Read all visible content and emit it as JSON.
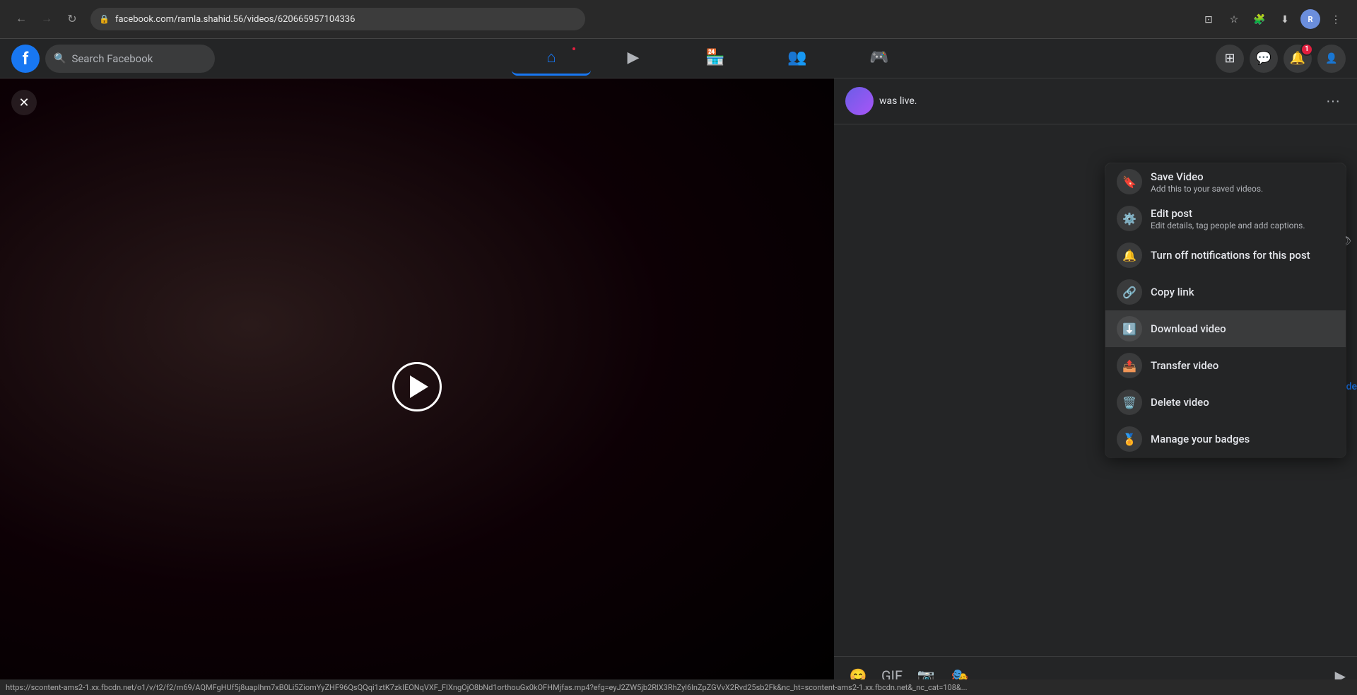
{
  "browser": {
    "url": "facebook.com/ramla.shahid.56/videos/620665957104336",
    "back_disabled": false,
    "forward_disabled": true,
    "status_url": "https://scontent-ams2-1.xx.fbcdn.net/o1/v/t2/f2/m69/AQMFgHUf5j8uaplhm7xB0Li5ZiomYyZHF96QsQQqi1ztK7zkIEONqVXF_FIXngOjO8bNd1ortk ouGx0kOFHMjfas.mp4?efg=eyJ2ZW5jb2RlX3RhZyl6lnZpZGVvX2Rvd25sb2Fk&nc_ht=scontent-ams2-1.xx.fbcdn.net&_nc_cat=108&..."
  },
  "facebook": {
    "search_placeholder": "Search Facebook",
    "logo_letter": "f",
    "nav_notification_count": "1",
    "header_right": {
      "grid_label": "Menu",
      "messenger_label": "Messenger",
      "notification_label": "Notifications",
      "notification_count": "1"
    }
  },
  "post": {
    "was_live_text": "was live.",
    "more_btn_label": "···"
  },
  "context_menu": {
    "items": [
      {
        "id": "save-video",
        "title": "Save Video",
        "subtitle": "Add this to your saved videos.",
        "icon": "🔖"
      },
      {
        "id": "edit-post",
        "title": "Edit post",
        "subtitle": "Edit details, tag people and add captions.",
        "icon": "✏️"
      },
      {
        "id": "turn-off-notifications",
        "title": "Turn off notifications for this post",
        "subtitle": "",
        "icon": "🔔"
      },
      {
        "id": "copy-link",
        "title": "Copy link",
        "subtitle": "",
        "icon": "🔗"
      },
      {
        "id": "download-video",
        "title": "Download video",
        "subtitle": "",
        "icon": "⬇️",
        "active": true
      },
      {
        "id": "transfer-video",
        "title": "Transfer video",
        "subtitle": "",
        "icon": "📤"
      },
      {
        "id": "delete-video",
        "title": "Delete video",
        "subtitle": "",
        "icon": "🗑️"
      },
      {
        "id": "manage-badges",
        "title": "Manage your badges",
        "subtitle": "",
        "icon": "🏅"
      }
    ]
  },
  "video": {
    "play_label": "Play"
  },
  "status_bar": {
    "url": "https://scontent-ams2-1.xx.fbcdn.net/o1/v/t2/f2/m69/AQMFgHUf5j8uaplhm7xB0Li5ZiomYyZHF96QsQQqi1ztK7zkIEONqVXF_FIXngOjO8bNd1orthouGx0kOFHMjfas.mp4?efg=eyJ2ZW5jb2RlX3RhZyl6lnZpZGVvX2Rvd25sb2Fk&nc_ht=scontent-ams2-1.xx.fbcdn.net&_nc_cat=108&..."
  }
}
